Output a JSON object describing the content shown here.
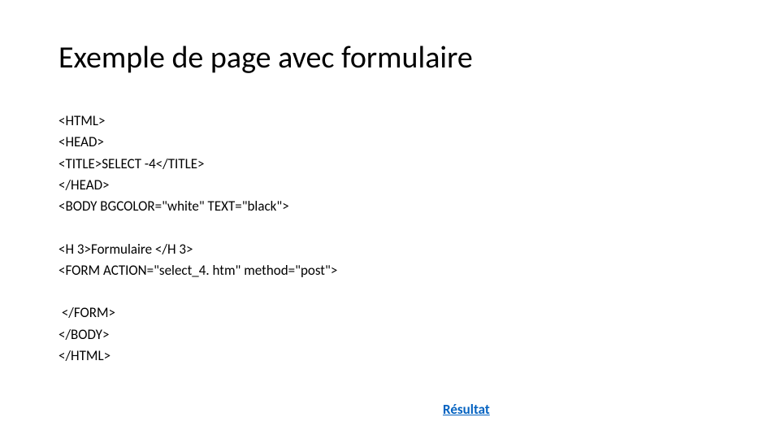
{
  "title": "Exemple de page avec formulaire",
  "code": {
    "l1": "<HTML>",
    "l2": "<HEAD>",
    "l3": "<TITLE>SELECT -4</TITLE>",
    "l4": "</HEAD>",
    "l5": "<BODY BGCOLOR=\"white\" TEXT=\"black\">",
    "l6": "<H 3>Formulaire </H 3>",
    "l7": "<FORM ACTION=\"select_4. htm\" method=\"post\">",
    "l8": " </FORM>",
    "l9": "</BODY>",
    "l10": "</HTML>"
  },
  "link": "Résultat"
}
